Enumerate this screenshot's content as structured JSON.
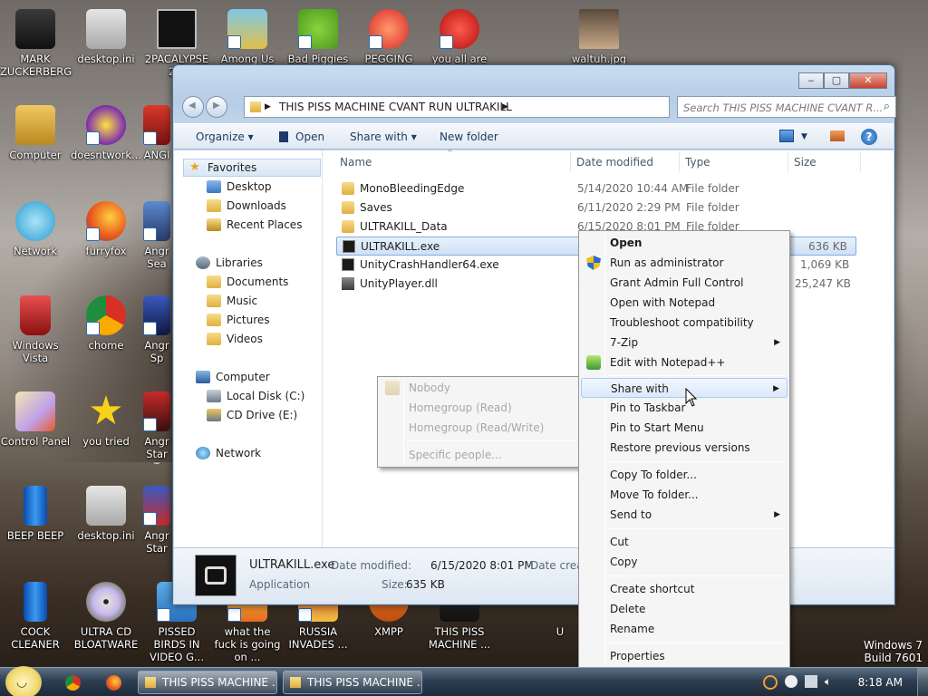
{
  "desktop": {
    "icons": [
      {
        "label": "MARK ZUCKERBERG",
        "icon": "person-icon"
      },
      {
        "label": "desktop.ini",
        "icon": "settings-file-icon"
      },
      {
        "label": "2PACALYPSE 2.3",
        "icon": "console-icon"
      },
      {
        "label": "Among Us",
        "icon": "game-icon"
      },
      {
        "label": "Bad Piggies",
        "icon": "pig-icon"
      },
      {
        "label": "PEGGING",
        "icon": "game-icon"
      },
      {
        "label": "you all are",
        "icon": "dev-cpp-icon"
      },
      {
        "label": "waltuh.jpg",
        "icon": "image-file-icon"
      },
      {
        "label": "Computer",
        "icon": "computer-icon"
      },
      {
        "label": "doesntwork...",
        "icon": "yahoo-icon"
      },
      {
        "label": "ANGI",
        "icon": "game-icon"
      },
      {
        "label": "Network",
        "icon": "network-icon"
      },
      {
        "label": "furryfox",
        "icon": "firefox-icon"
      },
      {
        "label": "Angr Sea",
        "icon": "game-icon"
      },
      {
        "label": "Windows Vista",
        "icon": "recycle-bin-icon"
      },
      {
        "label": "chome",
        "icon": "chrome-icon"
      },
      {
        "label": "Angr Sp",
        "icon": "game-icon"
      },
      {
        "label": "Control Panel",
        "icon": "control-panel-icon"
      },
      {
        "label": "you tried",
        "icon": "star-icon"
      },
      {
        "label": "Angr Star T",
        "icon": "game-icon"
      },
      {
        "label": "BEEP BEEP",
        "icon": "blue-bar-icon"
      },
      {
        "label": "desktop.ini",
        "icon": "settings-file-icon"
      },
      {
        "label": "Angr Star",
        "icon": "game-icon"
      },
      {
        "label": "COCK CLEANER",
        "icon": "blue-bar-icon"
      },
      {
        "label": "ULTRA CD BLOATWARE",
        "icon": "cd-icon"
      },
      {
        "label": "PISSED BIRDS IN VIDEO G...",
        "icon": "game-icon"
      },
      {
        "label": "what the fuck is going on ...",
        "icon": "game-icon"
      },
      {
        "label": "RUSSIA INVADES ...",
        "icon": "game-icon"
      },
      {
        "label": "XMPP",
        "icon": "chat-icon"
      },
      {
        "label": "THIS PISS MACHINE ...",
        "icon": "folder-icon"
      },
      {
        "label": "U",
        "icon": "game-icon"
      }
    ],
    "watermark_line1": "Windows 7",
    "watermark_line2": "Build 7601"
  },
  "window": {
    "minimize_glyph": "‒",
    "maximize_glyph": "▢",
    "close_glyph": "✕",
    "back_glyph": "◀",
    "forward_glyph": "▶",
    "address_path": "THIS PISS MACHINE CVANT RUN ULTRAKILL",
    "search_placeholder": "Search THIS PISS MACHINE CVANT R...",
    "toolbar": {
      "organize": "Organize",
      "open": "Open",
      "share_with": "Share with",
      "new_folder": "New folder"
    },
    "nav": {
      "favorites": "Favorites",
      "desktop": "Desktop",
      "downloads": "Downloads",
      "recent_places": "Recent Places",
      "libraries": "Libraries",
      "documents": "Documents",
      "music": "Music",
      "pictures": "Pictures",
      "videos": "Videos",
      "computer": "Computer",
      "local_disk": "Local Disk (C:)",
      "cd_drive": "CD Drive (E:)",
      "network": "Network"
    },
    "columns": {
      "name": "Name",
      "date": "Date modified",
      "type": "Type",
      "size": "Size"
    },
    "files": [
      {
        "name": "MonoBleedingEdge",
        "date": "5/14/2020 10:44 AM",
        "type": "File folder",
        "size": "",
        "kind": "folder"
      },
      {
        "name": "Saves",
        "date": "6/11/2020 2:29 PM",
        "type": "File folder",
        "size": "",
        "kind": "folder"
      },
      {
        "name": "ULTRAKILL_Data",
        "date": "6/15/2020 8:01 PM",
        "type": "File folder",
        "size": "",
        "kind": "folder"
      },
      {
        "name": "ULTRAKILL.exe",
        "date": "6",
        "type": "",
        "size": "636 KB",
        "kind": "exe"
      },
      {
        "name": "UnityCrashHandler64.exe",
        "date": "6",
        "type": "",
        "size": "1,069 KB",
        "kind": "exe"
      },
      {
        "name": "UnityPlayer.dll",
        "date": "6",
        "type": "",
        "size": "25,247 KB",
        "kind": "dll"
      }
    ],
    "details": {
      "name": "ULTRAKILL.exe",
      "kind": "Application",
      "date_label": "Date modified:",
      "date_value": "6/15/2020 8:01 PM",
      "size_label": "Size:",
      "size_value": "635 KB",
      "created_label": "Date creat"
    }
  },
  "context_menu": {
    "items": [
      "Open",
      "Run as administrator",
      "Grant Admin Full Control",
      "Open with Notepad",
      "Troubleshoot compatibility",
      "7-Zip",
      "Edit with Notepad++",
      "Share with",
      "Pin to Taskbar",
      "Pin to Start Menu",
      "Restore previous versions",
      "Copy To folder...",
      "Move To folder...",
      "Send to",
      "Cut",
      "Copy",
      "Create shortcut",
      "Delete",
      "Rename",
      "Properties"
    ]
  },
  "share_submenu": {
    "items": [
      "Nobody",
      "Homegroup (Read)",
      "Homegroup (Read/Write)",
      "Specific people..."
    ]
  },
  "taskbar": {
    "buttons": [
      "THIS PISS MACHINE ...",
      "THIS PISS MACHINE ..."
    ],
    "clock": "8:18 AM"
  },
  "colors": {
    "accent": "#2a6fc2",
    "selection": "#cfe1f6",
    "menu_bg": "#f5f5f5"
  }
}
